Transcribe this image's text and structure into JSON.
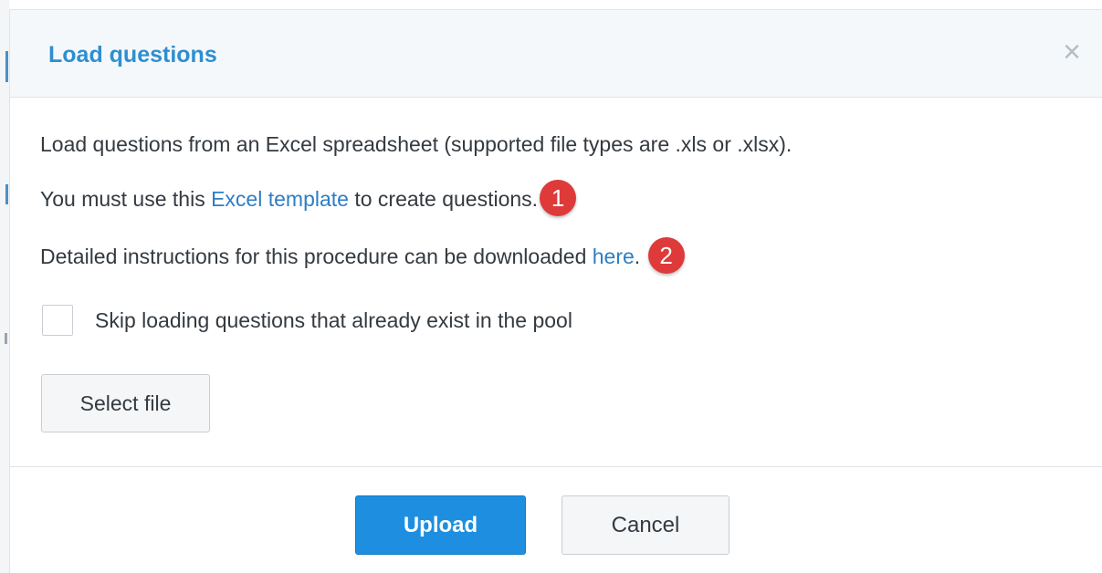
{
  "dialog": {
    "title": "Load questions",
    "close_glyph": "×",
    "intro_text": "Load questions from an Excel spreadsheet (supported file types are .xls or .xlsx).",
    "template_line": {
      "before": "You must use this ",
      "link": "Excel template",
      "after": " to create questions.",
      "badge": "1"
    },
    "instructions_line": {
      "before": "Detailed instructions for this procedure can be downloaded ",
      "link": "here",
      "after": ".",
      "badge": "2"
    },
    "skip_checkbox": {
      "label": "Skip loading questions that already exist in the pool",
      "checked": false
    },
    "select_file_label": "Select file",
    "footer": {
      "upload_label": "Upload",
      "cancel_label": "Cancel"
    }
  },
  "icons": {
    "close": "close-icon"
  },
  "colors": {
    "title": "#2d8fd1",
    "link": "#2d7ec4",
    "badge": "#de3a3a",
    "primary_button": "#1e8fe0",
    "header_background": "#f5f8fb"
  }
}
